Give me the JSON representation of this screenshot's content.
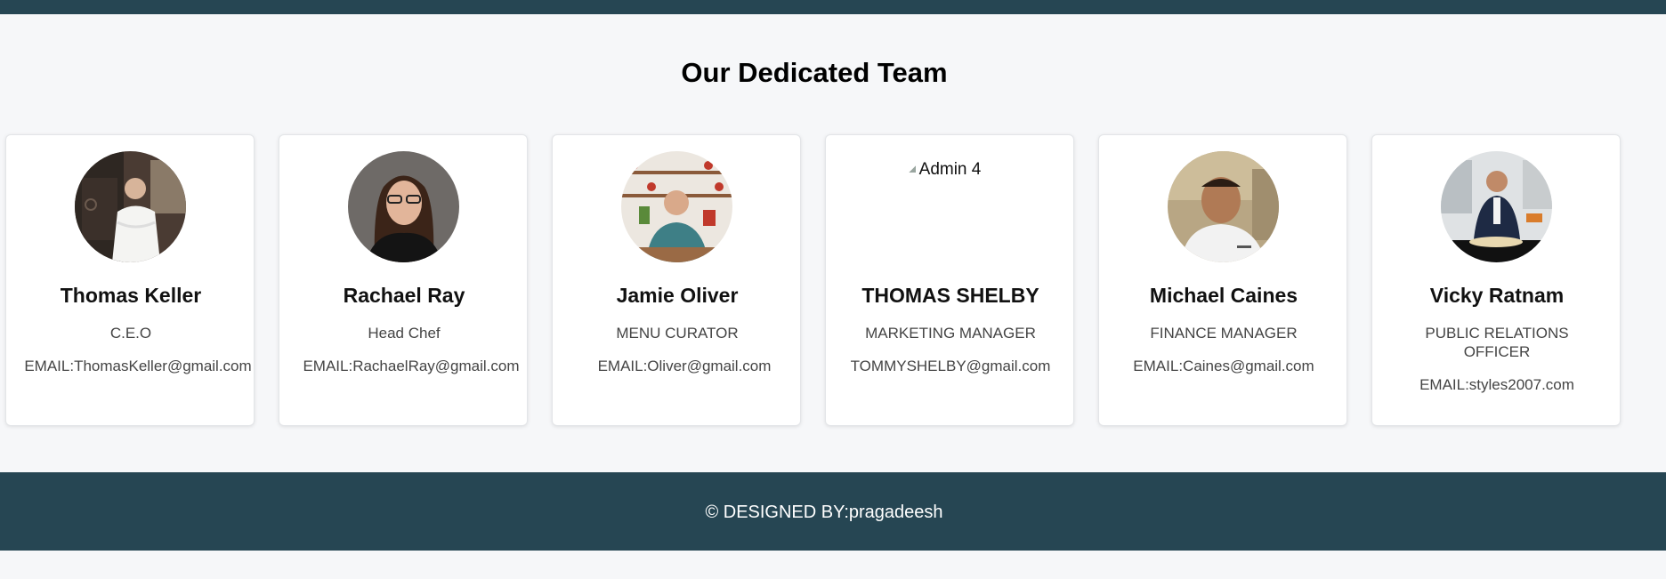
{
  "section": {
    "title": "Our Dedicated Team"
  },
  "team": [
    {
      "name": "Thomas Keller",
      "role": "C.E.O",
      "email": "EMAIL:ThomasKeller@gmail.com",
      "avatar": "chef-white-coat-photo"
    },
    {
      "name": "Rachael Ray",
      "role": "Head Chef",
      "email": "EMAIL:RachaelRay@gmail.com",
      "avatar": "woman-glasses-photo"
    },
    {
      "name": "Jamie Oliver",
      "role": "MENU CURATOR",
      "email": "EMAIL:Oliver@gmail.com",
      "avatar": "man-kitchen-shelves-photo"
    },
    {
      "name": "THOMAS SHELBY",
      "role": "MARKETING MANAGER",
      "email": "TOMMYSHELBY@gmail.com",
      "avatar_alt": "Admin 4"
    },
    {
      "name": "Michael Caines",
      "role": "FINANCE MANAGER",
      "email": "EMAIL:Caines@gmail.com",
      "avatar": "chef-portrait-photo"
    },
    {
      "name": "Vicky Ratnam",
      "role": "PUBLIC RELATIONS OFFICER",
      "email": "EMAIL:styles2007.com",
      "avatar": "man-suit-kitchen-photo"
    }
  ],
  "footer": {
    "text": "© DESIGNED BY:pragadeesh"
  },
  "colors": {
    "header_footer": "#264653",
    "background": "#f6f7f9",
    "card": "#ffffff"
  }
}
